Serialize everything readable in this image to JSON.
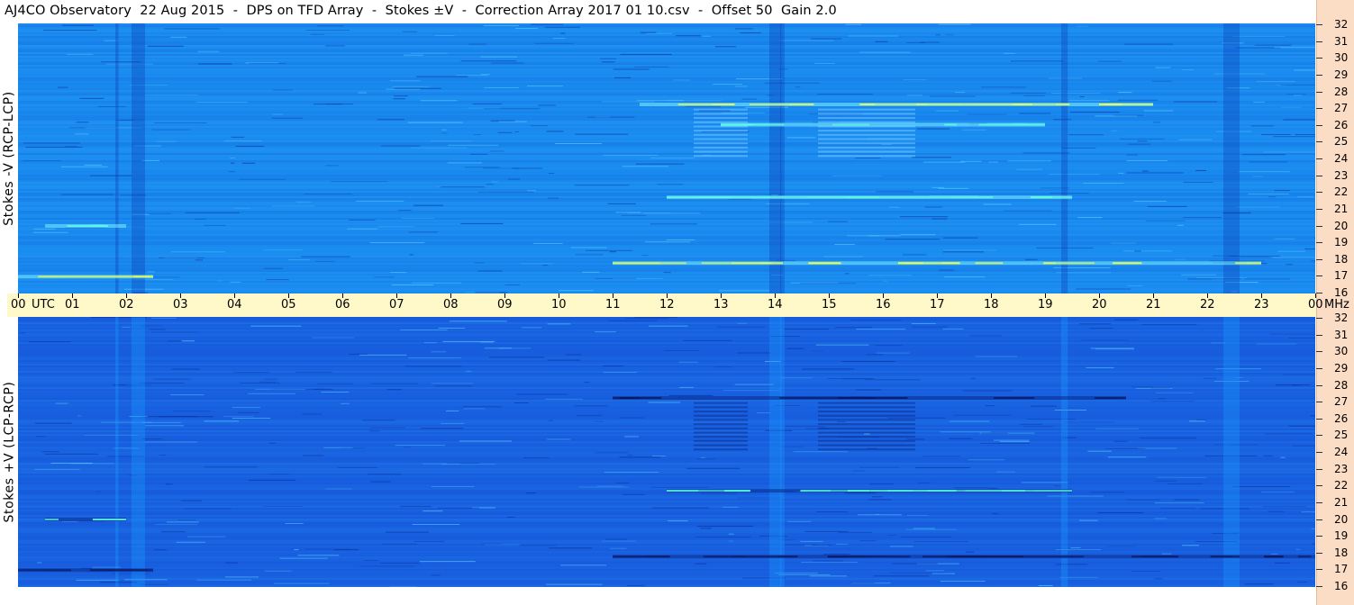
{
  "title": "AJ4CO Observatory  22 Aug 2015  -  DPS on TFD Array  -  Stokes ±V  -  Correction Array 2017 01 10.csv  -  Offset 50  Gain 2.0",
  "time_axis": {
    "start_label": "00",
    "utc_label": "UTC",
    "hour_labels": [
      "01",
      "02",
      "03",
      "04",
      "05",
      "06",
      "07",
      "08",
      "09",
      "10",
      "11",
      "12",
      "13",
      "14",
      "15",
      "16",
      "17",
      "18",
      "19",
      "20",
      "21",
      "22",
      "23"
    ],
    "end_label": "00",
    "unit_label": "MHz"
  },
  "colors": {
    "title_bg": "#ffffff",
    "timebar_bg": "#fff8c8",
    "right_strip_bg": "#fbdcc4",
    "top_panel_base": "#1a8cf0",
    "bottom_panel_base": "#1860e0",
    "hot": "#f2ff40",
    "dark": "#0a1660"
  },
  "chart_data": [
    {
      "type": "heatmap",
      "ylabel": "Stokes -V  (RCP-LCP)",
      "x_range_utc_hours": [
        0,
        24
      ],
      "y_range_mhz": [
        16,
        32
      ],
      "y_ticks": [
        "32",
        "31",
        "30",
        "29",
        "28",
        "27",
        "26",
        "25",
        "24",
        "23",
        "22",
        "21",
        "20",
        "19",
        "18",
        "17",
        "16"
      ],
      "bands": [
        {
          "mhz": 27.2,
          "t_start": 11.5,
          "t_end": 21.0,
          "level": "hot"
        },
        {
          "mhz": 17.8,
          "t_start": 11.0,
          "t_end": 23.0,
          "level": "hot"
        },
        {
          "mhz": 17.0,
          "t_start": 0.0,
          "t_end": 2.5,
          "level": "hot"
        },
        {
          "mhz": 20.0,
          "t_start": 0.5,
          "t_end": 2.0,
          "level": "warm"
        },
        {
          "mhz": 21.7,
          "t_start": 12.0,
          "t_end": 19.5,
          "level": "warm"
        },
        {
          "mhz": 26.0,
          "t_start": 13.0,
          "t_end": 19.0,
          "level": "warm"
        }
      ]
    },
    {
      "type": "heatmap",
      "ylabel": "Stokes +V  (LCP-RCP)",
      "x_range_utc_hours": [
        0,
        24
      ],
      "y_range_mhz": [
        16,
        32
      ],
      "y_ticks": [
        "32",
        "31",
        "30",
        "29",
        "28",
        "27",
        "26",
        "25",
        "24",
        "23",
        "22",
        "21",
        "20",
        "19",
        "18",
        "17",
        "16"
      ],
      "bands": [
        {
          "mhz": 27.2,
          "t_start": 11.0,
          "t_end": 20.5,
          "level": "dark"
        },
        {
          "mhz": 17.8,
          "t_start": 11.0,
          "t_end": 24.0,
          "level": "dark"
        },
        {
          "mhz": 17.0,
          "t_start": 0.0,
          "t_end": 2.5,
          "level": "dark"
        },
        {
          "mhz": 21.7,
          "t_start": 12.0,
          "t_end": 19.5,
          "level": "warm"
        },
        {
          "mhz": 20.0,
          "t_start": 0.5,
          "t_end": 2.0,
          "level": "warm"
        }
      ]
    }
  ]
}
